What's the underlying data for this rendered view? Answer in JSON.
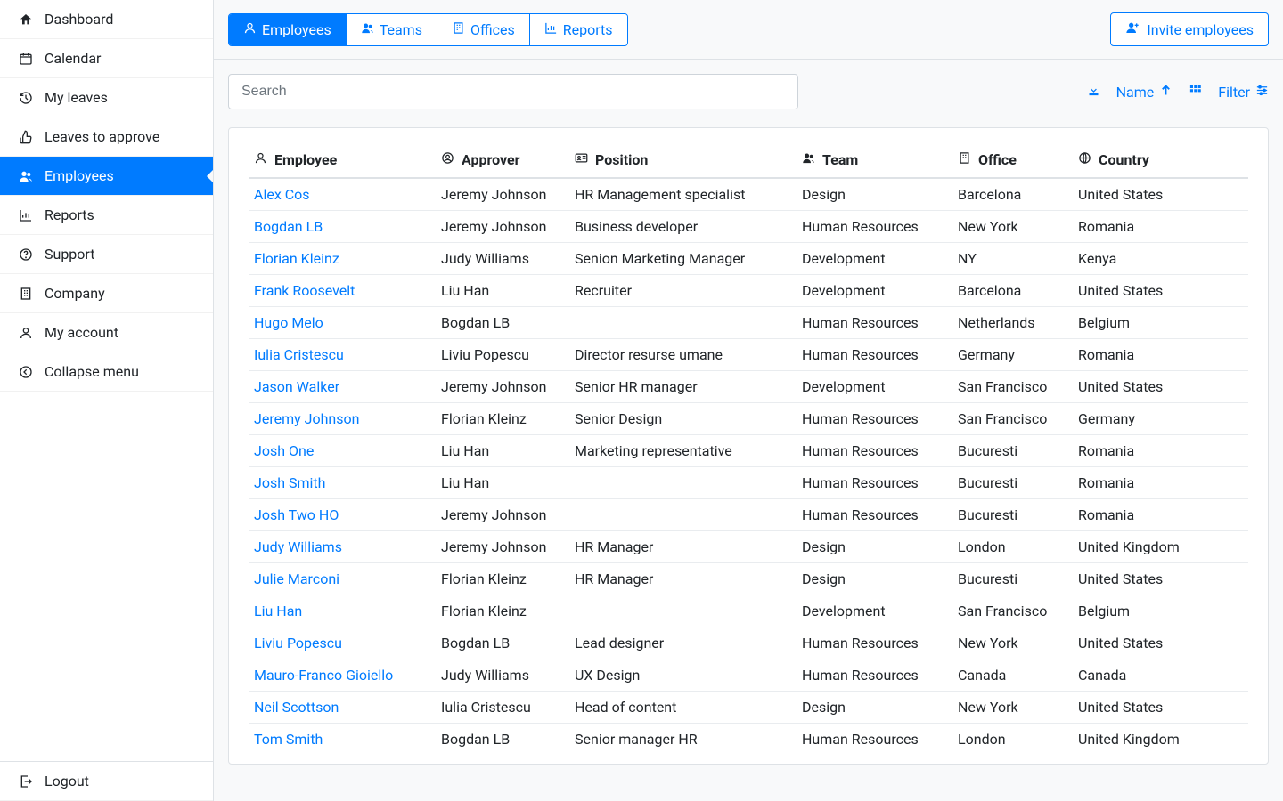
{
  "sidebar": {
    "items": [
      {
        "label": "Dashboard"
      },
      {
        "label": "Calendar"
      },
      {
        "label": "My leaves"
      },
      {
        "label": "Leaves to approve"
      },
      {
        "label": "Employees"
      },
      {
        "label": "Reports"
      },
      {
        "label": "Support"
      },
      {
        "label": "Company"
      },
      {
        "label": "My account"
      },
      {
        "label": "Collapse menu"
      }
    ],
    "logout_label": "Logout"
  },
  "tabs": {
    "employees": "Employees",
    "teams": "Teams",
    "offices": "Offices",
    "reports": "Reports"
  },
  "invite_button": "Invite employees",
  "search": {
    "placeholder": "Search"
  },
  "toolbar": {
    "name_label": "Name",
    "filter_label": "Filter"
  },
  "table": {
    "headers": {
      "employee": "Employee",
      "approver": "Approver",
      "position": "Position",
      "team": "Team",
      "office": "Office",
      "country": "Country"
    },
    "rows": [
      {
        "employee": "Alex Cos",
        "approver": "Jeremy Johnson",
        "position": "HR Management specialist",
        "team": "Design",
        "office": "Barcelona",
        "country": "United States"
      },
      {
        "employee": "Bogdan LB",
        "approver": "Jeremy Johnson",
        "position": "Business developer",
        "team": "Human Resources",
        "office": "New York",
        "country": "Romania"
      },
      {
        "employee": "Florian Kleinz",
        "approver": "Judy Williams",
        "position": "Senion Marketing Manager",
        "team": "Development",
        "office": "NY",
        "country": "Kenya"
      },
      {
        "employee": "Frank Roosevelt",
        "approver": "Liu Han",
        "position": "Recruiter",
        "team": "Development",
        "office": "Barcelona",
        "country": "United States"
      },
      {
        "employee": "Hugo Melo",
        "approver": "Bogdan LB",
        "position": "",
        "team": "Human Resources",
        "office": "Netherlands",
        "country": "Belgium"
      },
      {
        "employee": "Iulia Cristescu",
        "approver": "Liviu Popescu",
        "position": "Director resurse umane",
        "team": "Human Resources",
        "office": "Germany",
        "country": "Romania"
      },
      {
        "employee": "Jason Walker",
        "approver": "Jeremy Johnson",
        "position": "Senior HR manager",
        "team": "Development",
        "office": "San Francisco",
        "country": "United States"
      },
      {
        "employee": "Jeremy Johnson",
        "approver": "Florian Kleinz",
        "position": "Senior Design",
        "team": "Human Resources",
        "office": "San Francisco",
        "country": "Germany"
      },
      {
        "employee": "Josh One",
        "approver": "Liu Han",
        "position": "Marketing representative",
        "team": "Human Resources",
        "office": "Bucuresti",
        "country": "Romania"
      },
      {
        "employee": "Josh Smith",
        "approver": "Liu Han",
        "position": "",
        "team": "Human Resources",
        "office": "Bucuresti",
        "country": "Romania"
      },
      {
        "employee": "Josh Two HO",
        "approver": "Jeremy Johnson",
        "position": "",
        "team": "Human Resources",
        "office": "Bucuresti",
        "country": "Romania"
      },
      {
        "employee": "Judy Williams",
        "approver": "Jeremy Johnson",
        "position": "HR Manager",
        "team": "Design",
        "office": "London",
        "country": "United Kingdom"
      },
      {
        "employee": "Julie Marconi",
        "approver": "Florian Kleinz",
        "position": "HR Manager",
        "team": "Design",
        "office": "Bucuresti",
        "country": "United States"
      },
      {
        "employee": "Liu Han",
        "approver": "Florian Kleinz",
        "position": "",
        "team": "Development",
        "office": "San Francisco",
        "country": "Belgium"
      },
      {
        "employee": "Liviu Popescu",
        "approver": "Bogdan LB",
        "position": "Lead designer",
        "team": "Human Resources",
        "office": "New York",
        "country": "United States"
      },
      {
        "employee": "Mauro-Franco Gioiello",
        "approver": "Judy Williams",
        "position": "UX Design",
        "team": "Human Resources",
        "office": "Canada",
        "country": "Canada"
      },
      {
        "employee": "Neil Scottson",
        "approver": "Iulia Cristescu",
        "position": "Head of content",
        "team": "Design",
        "office": "New York",
        "country": "United States"
      },
      {
        "employee": "Tom Smith",
        "approver": "Bogdan LB",
        "position": "Senior manager HR",
        "team": "Human Resources",
        "office": "London",
        "country": "United Kingdom"
      }
    ]
  }
}
